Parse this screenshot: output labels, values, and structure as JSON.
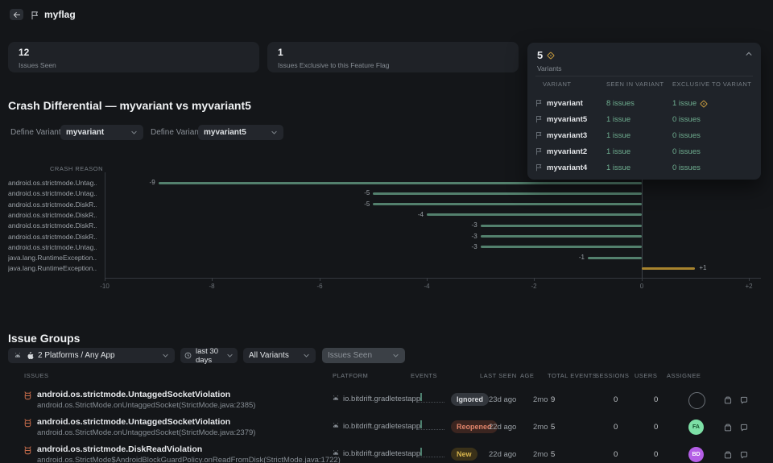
{
  "header": {
    "title": "myflag"
  },
  "stats": {
    "card1": {
      "value": "12",
      "label": "Issues Seen"
    },
    "card2": {
      "value": "1",
      "label": "Issues Exclusive to this Feature Flag"
    },
    "variants_panel": {
      "value": "5",
      "label": "Variants",
      "columns": [
        "VARIANT",
        "SEEN IN VARIANT",
        "EXCLUSIVE TO VARIANT"
      ],
      "rows": [
        {
          "name": "myvariant",
          "seen": "8 issues",
          "exclusive": "1 issue",
          "exclusive_flag": true
        },
        {
          "name": "myvariant5",
          "seen": "1 issue",
          "exclusive": "0 issues",
          "exclusive_flag": false
        },
        {
          "name": "myvariant3",
          "seen": "1 issue",
          "exclusive": "0 issues",
          "exclusive_flag": false
        },
        {
          "name": "myvariant2",
          "seen": "1 issue",
          "exclusive": "0 issues",
          "exclusive_flag": false
        },
        {
          "name": "myvariant4",
          "seen": "1 issue",
          "exclusive": "0 issues",
          "exclusive_flag": false
        }
      ]
    }
  },
  "crash_differential": {
    "title": "Crash Differential — myvariant vs myvariant5",
    "variant_a_label": "Define Variant A",
    "variant_a_value": "myvariant",
    "variant_b_label": "Define Variant B",
    "variant_b_value": "myvariant5"
  },
  "chart_data": {
    "type": "bar",
    "orientation": "horizontal",
    "axis_header": "CRASH REASON",
    "categories": [
      "android.os.strictmode.Untag...",
      "android.os.strictmode.Untag...",
      "android.os.strictmode.DiskR...",
      "android.os.strictmode.DiskR...",
      "android.os.strictmode.DiskR...",
      "android.os.strictmode.DiskR...",
      "android.os.strictmode.Untag...",
      "java.lang.RuntimeException...",
      "java.lang.RuntimeException..."
    ],
    "values": [
      -9,
      -5,
      -5,
      -4,
      -3,
      -3,
      -3,
      -1,
      1
    ],
    "bar_labels": [
      "-9",
      "-5",
      "-5",
      "-4",
      "-3",
      "-3",
      "-3",
      "-1",
      "+1"
    ],
    "xlim": [
      -10,
      2
    ],
    "xticks": [
      -10,
      -8,
      -6,
      -4,
      -2,
      0,
      2
    ],
    "xtick_labels": [
      "-10",
      "-8",
      "-6",
      "-4",
      "-2",
      "0",
      "+2"
    ],
    "negative_color": "#53806d",
    "positive_color": "#a8842e",
    "grid": false
  },
  "issue_groups": {
    "title": "Issue Groups",
    "filters": {
      "platforms": "2 Platforms / Any App",
      "date_range": "last 30 days",
      "variants": "All Variants",
      "metric": "Issues Seen"
    },
    "columns": [
      "ISSUES",
      "PLATFORM",
      "EVENTS",
      "LAST SEEN",
      "AGE",
      "TOTAL EVENTS",
      "SESSIONS",
      "USERS",
      "ASSIGNEE"
    ],
    "rows": [
      {
        "title": "android.os.strictmode.UntaggedSocketViolation",
        "subtitle": "android.os.StrictMode.onUntaggedSocket(StrictMode.java:2385)",
        "platform": "io.bitdrift.gradletestapp",
        "status": "Ignored",
        "status_type": "ignored",
        "last_seen": "23d ago",
        "age": "2mo",
        "total_events": "9",
        "sessions": "0",
        "users": "0",
        "assignee": {
          "type": "empty",
          "initials": ""
        }
      },
      {
        "title": "android.os.strictmode.UntaggedSocketViolation",
        "subtitle": "android.os.StrictMode.onUntaggedSocket(StrictMode.java:2379)",
        "platform": "io.bitdrift.gradletestapp",
        "status": "Reopened",
        "status_type": "reopened",
        "last_seen": "22d ago",
        "age": "2mo",
        "total_events": "5",
        "sessions": "0",
        "users": "0",
        "assignee": {
          "type": "green",
          "initials": "FA"
        }
      },
      {
        "title": "android.os.strictmode.DiskReadViolation",
        "subtitle": "android.os.StrictMode$AndroidBlockGuardPolicy.onReadFromDisk(StrictMode.java:1722)",
        "platform": "io.bitdrift.gradletestapp",
        "status": "New",
        "status_type": "new",
        "last_seen": "22d ago",
        "age": "2mo",
        "total_events": "5",
        "sessions": "0",
        "users": "0",
        "assignee": {
          "type": "purple",
          "initials": "BD"
        }
      }
    ]
  },
  "colors": {
    "background": "#141619",
    "card": "#1f2227",
    "link_green": "#6fae90",
    "bar_negative": "#53806d",
    "bar_positive": "#a8842e",
    "badge_ignored": "#33373d",
    "badge_reopened_text": "#e0846a",
    "badge_new_text": "#d6b44c",
    "avatar_green": "#7de0a6",
    "avatar_purple": "#b45ee6",
    "flag_gold": "#c59a3f"
  }
}
